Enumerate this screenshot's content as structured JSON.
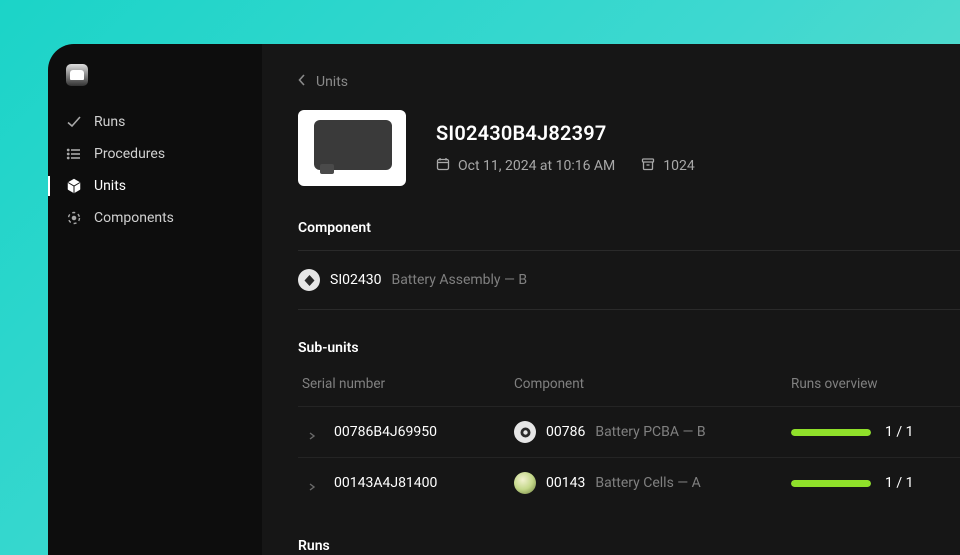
{
  "sidebar": {
    "items": [
      {
        "label": "Runs",
        "icon": "check-icon"
      },
      {
        "label": "Procedures",
        "icon": "list-icon"
      },
      {
        "label": "Units",
        "icon": "box-icon"
      },
      {
        "label": "Components",
        "icon": "target-icon"
      }
    ],
    "active_index": 2
  },
  "breadcrumb": {
    "label": "Units"
  },
  "unit": {
    "serial": "SI02430B4J82397",
    "created_at": "Oct 11, 2024 at 10:16 AM",
    "archive_code": "1024"
  },
  "component_section": {
    "title": "Component",
    "code": "SI02430",
    "name": "Battery Assembly — B"
  },
  "subunits": {
    "title": "Sub-units",
    "columns": {
      "serial": "Serial number",
      "component": "Component",
      "runs": "Runs overview"
    },
    "rows": [
      {
        "serial": "00786B4J69950",
        "code": "00786",
        "name": "Battery PCBA — B",
        "runs_done": 1,
        "runs_total": 1,
        "icon": "pcba"
      },
      {
        "serial": "00143A4J81400",
        "code": "00143",
        "name": "Battery Cells — A",
        "runs_done": 1,
        "runs_total": 1,
        "icon": "cells"
      }
    ]
  },
  "runs_section": {
    "title": "Runs"
  },
  "colors": {
    "accent": "#8fe02a"
  }
}
